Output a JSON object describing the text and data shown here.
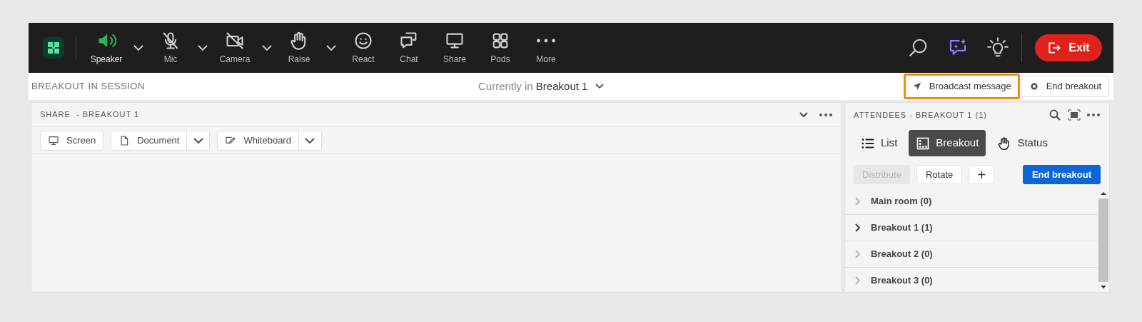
{
  "toolbar": {
    "items": [
      {
        "kind": "speaker",
        "label": "Speaker",
        "active": true,
        "has_menu": true
      },
      {
        "kind": "mic-off",
        "label": "Mic",
        "active": false,
        "has_menu": true
      },
      {
        "kind": "camera-off",
        "label": "Camera",
        "active": false,
        "has_menu": true
      },
      {
        "kind": "hand",
        "label": "Raise",
        "active": false,
        "has_menu": true
      },
      {
        "kind": "smile",
        "label": "React",
        "active": false,
        "has_menu": false
      },
      {
        "kind": "chat",
        "label": "Chat",
        "active": false,
        "has_menu": false
      },
      {
        "kind": "screen",
        "label": "Share",
        "active": false,
        "has_menu": false
      },
      {
        "kind": "pods",
        "label": "Pods",
        "active": false,
        "has_menu": false
      },
      {
        "kind": "more",
        "label": "More",
        "active": false,
        "has_menu": false
      }
    ],
    "exit_button": "Exit"
  },
  "session_bar": {
    "status": "BREAKOUT IN SESSION",
    "current_prefix": "Currently in",
    "current_room": "Breakout 1",
    "buttons": [
      {
        "kind": "send",
        "label": "Broadcast message",
        "highlighted": true
      },
      {
        "kind": "stop",
        "label": "End breakout",
        "highlighted": false
      }
    ]
  },
  "share_pod": {
    "title": "SHARE  - BREAKOUT 1",
    "buttons": [
      {
        "kind": "screen",
        "label": "Screen",
        "has_menu": false
      },
      {
        "kind": "document",
        "label": "Document",
        "has_menu": true
      },
      {
        "kind": "whiteboard",
        "label": "Whiteboard",
        "has_menu": true
      }
    ]
  },
  "attendees_pod": {
    "title": "ATTENDEES - BREAKOUT 1 (1)",
    "tabs": [
      {
        "kind": "list",
        "label": "List",
        "selected": false
      },
      {
        "kind": "breakout",
        "label": "Breakout",
        "selected": true
      },
      {
        "kind": "hand",
        "label": "Status",
        "selected": false
      }
    ],
    "actions": [
      {
        "kind": "plain",
        "label": "Distribute",
        "disabled": true
      },
      {
        "kind": "plain",
        "label": "Rotate",
        "disabled": false
      },
      {
        "kind": "add",
        "label": "+",
        "disabled": false
      },
      {
        "kind": "primary",
        "label": "End breakout",
        "disabled": false
      }
    ],
    "rooms": [
      {
        "label": "Main room (0)",
        "current": false
      },
      {
        "label": "Breakout 1 (1)",
        "current": true
      },
      {
        "label": "Breakout 2 (0)",
        "current": false
      },
      {
        "label": "Breakout 3 (0)",
        "current": false
      }
    ]
  }
}
